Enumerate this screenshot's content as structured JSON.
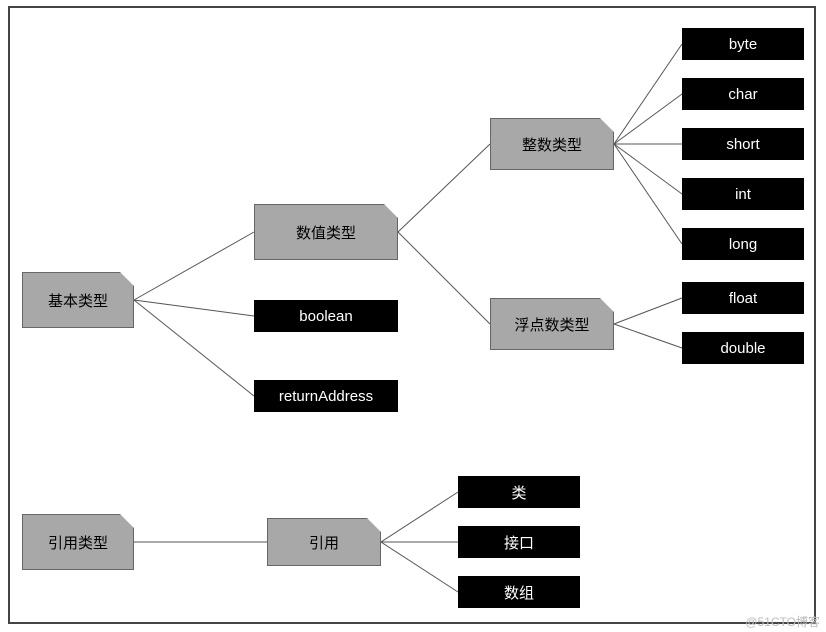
{
  "chart_data": {
    "type": "tree",
    "title": "",
    "roots": [
      {
        "name": "基本类型",
        "style": "gray",
        "children": [
          {
            "name": "数值类型",
            "style": "gray",
            "children": [
              {
                "name": "整数类型",
                "style": "gray",
                "children": [
                  {
                    "name": "byte",
                    "style": "black"
                  },
                  {
                    "name": "char",
                    "style": "black"
                  },
                  {
                    "name": "short",
                    "style": "black"
                  },
                  {
                    "name": "int",
                    "style": "black"
                  },
                  {
                    "name": "long",
                    "style": "black"
                  }
                ]
              },
              {
                "name": "浮点数类型",
                "style": "gray",
                "children": [
                  {
                    "name": "float",
                    "style": "black"
                  },
                  {
                    "name": "double",
                    "style": "black"
                  }
                ]
              }
            ]
          },
          {
            "name": "boolean",
            "style": "black"
          },
          {
            "name": "returnAddress",
            "style": "black"
          }
        ]
      },
      {
        "name": "引用类型",
        "style": "gray",
        "children": [
          {
            "name": "引用",
            "style": "gray",
            "children": [
              {
                "name": "类",
                "style": "black"
              },
              {
                "name": "接口",
                "style": "black"
              },
              {
                "name": "数组",
                "style": "black"
              }
            ]
          }
        ]
      }
    ]
  },
  "labels": {
    "basic_type": "基本类型",
    "numeric_type": "数值类型",
    "boolean": "boolean",
    "returnAddress": "returnAddress",
    "integer_type": "整数类型",
    "float_point_type": "浮点数类型",
    "byte": "byte",
    "char": "char",
    "short": "short",
    "int": "int",
    "long": "long",
    "float": "float",
    "double": "double",
    "reference_type": "引用类型",
    "reference": "引用",
    "class": "类",
    "interface": "接口",
    "array": "数组"
  },
  "watermark": "@51CTO博客"
}
